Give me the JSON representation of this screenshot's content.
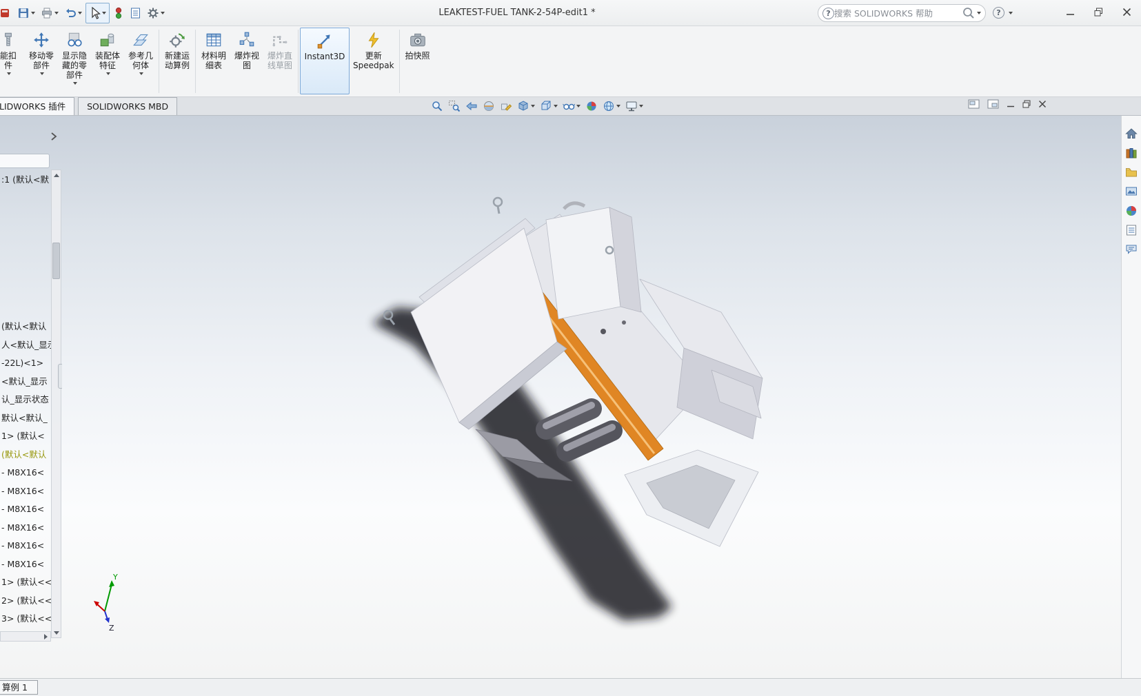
{
  "colors": {
    "accent_orange": "#e08624",
    "active_button_border": "#7da9d8",
    "tree_highlight_text": "#97970b",
    "viewport_top": "#c9d1db",
    "viewport_bottom": "#f3f4f4"
  },
  "titlebar": {
    "title": "LEAKTEST-FUEL TANK-2-54P-edit1 *",
    "search_placeholder": "搜索 SOLIDWORKS 帮助",
    "help_glyph": "?"
  },
  "qat_icons": [
    "app",
    "save",
    "print",
    "undo",
    "select-tool",
    "selection-filter",
    "design-binder",
    "options-gear"
  ],
  "ribbon": {
    "buttons": [
      {
        "l1": "能扣",
        "l2": "件"
      },
      {
        "l1": "移动零",
        "l2": "部件"
      },
      {
        "l1": "显示隐",
        "l2": "藏的零",
        "l3": "部件"
      },
      {
        "l1": "装配体",
        "l2": "特征"
      },
      {
        "l1": "参考几",
        "l2": "何体"
      },
      {
        "l1": "新建运",
        "l2": "动算例"
      },
      {
        "l1": "材料明",
        "l2": "细表"
      },
      {
        "l1": "爆炸视",
        "l2": "图"
      },
      {
        "l1": "爆炸直",
        "l2": "线草图"
      },
      {
        "l1": "Instant3D"
      },
      {
        "l1": "更新",
        "l2": "Speedpak"
      },
      {
        "l1": "拍快照"
      }
    ]
  },
  "tabs": {
    "addins": "LIDWORKS 插件",
    "mbd": "SOLIDWORKS MBD"
  },
  "hud_icons": [
    "zoom-fit",
    "zoom-area",
    "previous-view",
    "section-view",
    "3d-drawing-view",
    "display-style",
    "view-orientation",
    "hide-show-items",
    "edit-appearance",
    "apply-scene",
    "view-settings"
  ],
  "feature_tree": {
    "top_item": ":1 (默认<默",
    "items": [
      "(默认<默认",
      "人<默认_显示",
      "-22L)<1>",
      "<默认_显示",
      "认_显示状态",
      "默认<默认_",
      "1> (默认<",
      "(默认<默认",
      " - M8X16<",
      " - M8X16<",
      " - M8X16<",
      " - M8X16<",
      " - M8X16<",
      " - M8X16<",
      "1> (默认<<",
      "2> (默认<<",
      "3> (默认<<"
    ]
  },
  "taskpane_icons": [
    "resources-home",
    "design-library",
    "file-explorer",
    "view-palette",
    "appearances-scenes",
    "custom-properties",
    "forum"
  ],
  "triad": {
    "y": "Y",
    "z": "Z"
  },
  "bottom": {
    "motion_tab": "算例 1"
  }
}
